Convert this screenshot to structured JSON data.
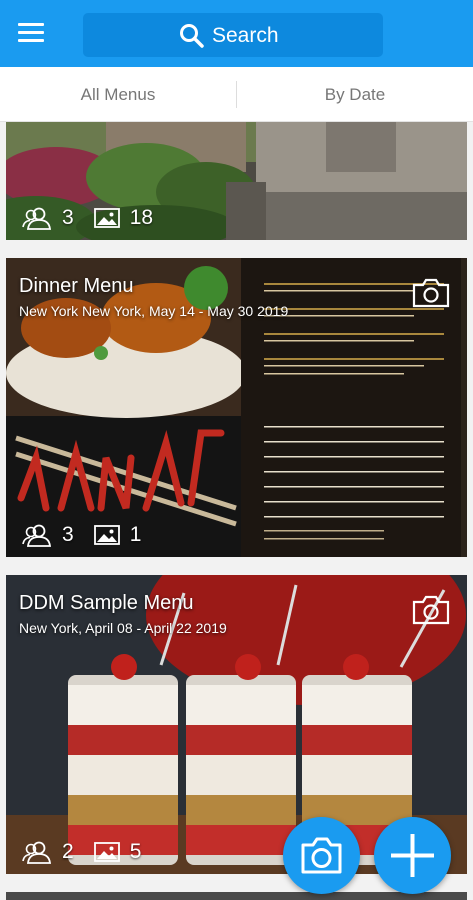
{
  "header": {
    "search_label": "Search"
  },
  "tabs": [
    {
      "label": "All Menus"
    },
    {
      "label": "By Date"
    }
  ],
  "cards": [
    {
      "title": "",
      "subtitle": "",
      "people_count": "3",
      "photo_count": "18"
    },
    {
      "title": "Dinner Menu",
      "subtitle": "New York New York, May 14 - May 30 2019",
      "people_count": "3",
      "photo_count": "1"
    },
    {
      "title": "DDM Sample Menu",
      "subtitle": "New York, April 08 - April 22 2019",
      "people_count": "2",
      "photo_count": "5"
    }
  ],
  "colors": {
    "primary": "#1a9bf0",
    "primary_dark": "#0d89de"
  },
  "icons": [
    "hamburger-menu-icon",
    "search-icon",
    "camera-icon",
    "users-icon",
    "image-icon",
    "plus-icon"
  ]
}
